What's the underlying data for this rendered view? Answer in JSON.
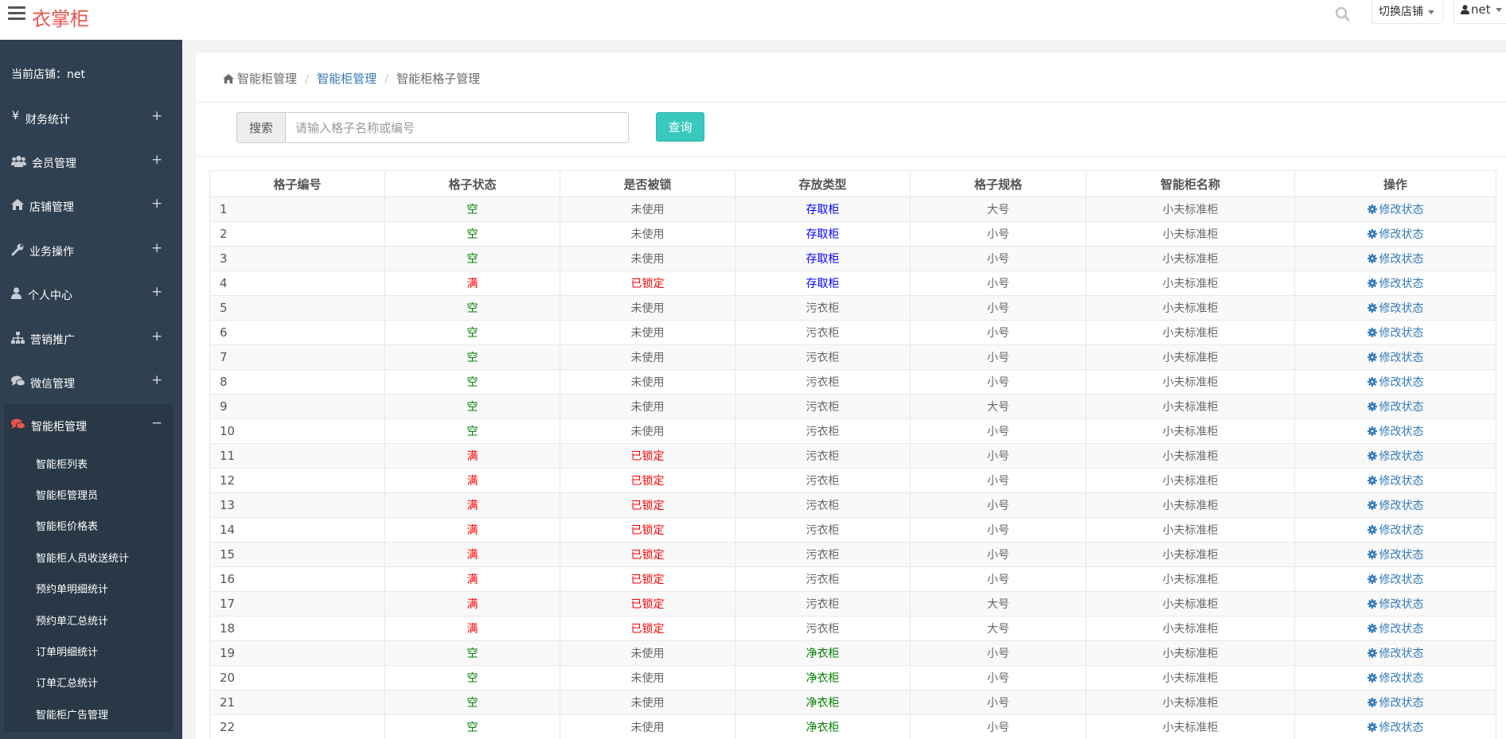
{
  "app": {
    "brand": "衣掌柜"
  },
  "topbar": {
    "switch_store": "切换店铺",
    "user": "net"
  },
  "sidebar": {
    "store_info": "当前店铺：net",
    "items": [
      {
        "label": "财务统计",
        "icon": "yen-icon",
        "toggle": "+"
      },
      {
        "label": "会员管理",
        "icon": "users-icon",
        "toggle": "+"
      },
      {
        "label": "店铺管理",
        "icon": "home-icon",
        "toggle": "+"
      },
      {
        "label": "业务操作",
        "icon": "wrench-icon",
        "toggle": "+"
      },
      {
        "label": "个人中心",
        "icon": "user-icon",
        "toggle": "+"
      },
      {
        "label": "营销推广",
        "icon": "sitemap-icon",
        "toggle": "+"
      },
      {
        "label": "微信管理",
        "icon": "comments-icon",
        "toggle": "+"
      },
      {
        "label": "智能柜管理",
        "icon": "comments-icon",
        "toggle": "−",
        "active": true
      }
    ],
    "sub_items": [
      "智能柜列表",
      "智能柜管理员",
      "智能柜价格表",
      "智能柜人员收送统计",
      "预约单明细统计",
      "预约单汇总统计",
      "订单明细统计",
      "订单汇总统计",
      "智能柜广告管理"
    ]
  },
  "breadcrumb": [
    "智能柜管理",
    "智能柜管理",
    "智能柜格子管理"
  ],
  "search": {
    "addon": "搜索",
    "placeholder": "请输入格子名称或编号",
    "button": "查询"
  },
  "table": {
    "columns": [
      "格子编号",
      "格子状态",
      "是否被锁",
      "存放类型",
      "格子规格",
      "智能柜名称",
      "操作"
    ],
    "action_label": "修改状态",
    "rows": [
      [
        "1",
        "空",
        "未使用",
        "存取柜",
        "大号",
        "小夫标准柜"
      ],
      [
        "2",
        "空",
        "未使用",
        "存取柜",
        "小号",
        "小夫标准柜"
      ],
      [
        "3",
        "空",
        "未使用",
        "存取柜",
        "小号",
        "小夫标准柜"
      ],
      [
        "4",
        "满",
        "已锁定",
        "存取柜",
        "小号",
        "小夫标准柜"
      ],
      [
        "5",
        "空",
        "未使用",
        "污衣柜",
        "小号",
        "小夫标准柜"
      ],
      [
        "6",
        "空",
        "未使用",
        "污衣柜",
        "小号",
        "小夫标准柜"
      ],
      [
        "7",
        "空",
        "未使用",
        "污衣柜",
        "小号",
        "小夫标准柜"
      ],
      [
        "8",
        "空",
        "未使用",
        "污衣柜",
        "小号",
        "小夫标准柜"
      ],
      [
        "9",
        "空",
        "未使用",
        "污衣柜",
        "大号",
        "小夫标准柜"
      ],
      [
        "10",
        "空",
        "未使用",
        "污衣柜",
        "小号",
        "小夫标准柜"
      ],
      [
        "11",
        "满",
        "已锁定",
        "污衣柜",
        "小号",
        "小夫标准柜"
      ],
      [
        "12",
        "满",
        "已锁定",
        "污衣柜",
        "小号",
        "小夫标准柜"
      ],
      [
        "13",
        "满",
        "已锁定",
        "污衣柜",
        "小号",
        "小夫标准柜"
      ],
      [
        "14",
        "满",
        "已锁定",
        "污衣柜",
        "小号",
        "小夫标准柜"
      ],
      [
        "15",
        "满",
        "已锁定",
        "污衣柜",
        "小号",
        "小夫标准柜"
      ],
      [
        "16",
        "满",
        "已锁定",
        "污衣柜",
        "小号",
        "小夫标准柜"
      ],
      [
        "17",
        "满",
        "已锁定",
        "污衣柜",
        "大号",
        "小夫标准柜"
      ],
      [
        "18",
        "满",
        "已锁定",
        "污衣柜",
        "大号",
        "小夫标准柜"
      ],
      [
        "19",
        "空",
        "未使用",
        "净衣柜",
        "小号",
        "小夫标准柜"
      ],
      [
        "20",
        "空",
        "未使用",
        "净衣柜",
        "小号",
        "小夫标准柜"
      ],
      [
        "21",
        "空",
        "未使用",
        "净衣柜",
        "小号",
        "小夫标准柜"
      ],
      [
        "22",
        "空",
        "未使用",
        "净衣柜",
        "小号",
        "小夫标准柜"
      ]
    ]
  },
  "colors": {
    "brand": "#e8554e",
    "sidebar_bg": "#2f4050",
    "status_empty": "#008000",
    "status_full": "#ff0000",
    "locked": "#ff0000",
    "type_access": "#0000ff",
    "type_dirty": "#666666",
    "type_clean": "#008000",
    "query_button": "#39c8c0",
    "link": "#337ab7"
  }
}
